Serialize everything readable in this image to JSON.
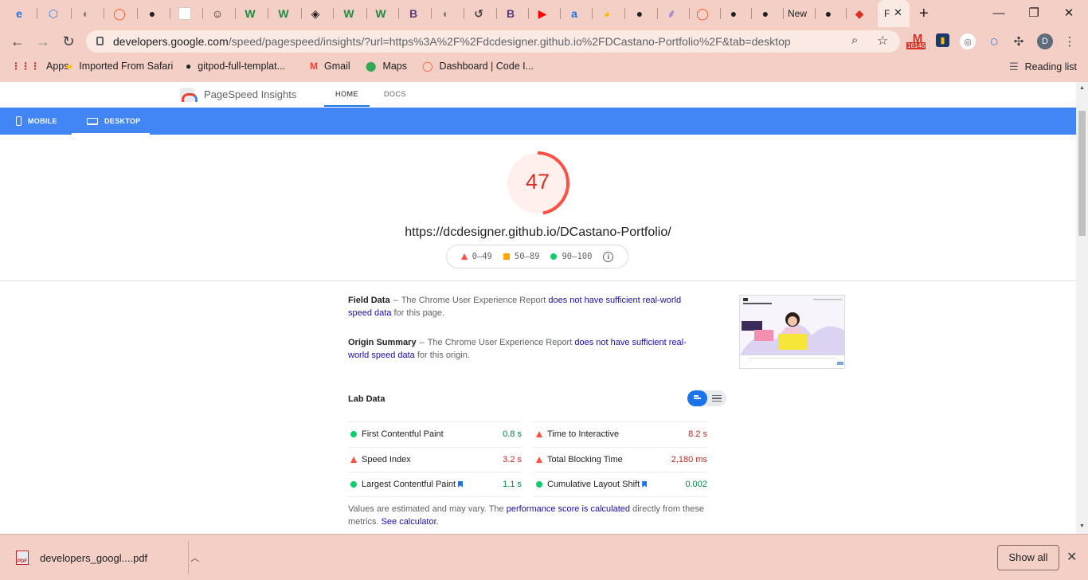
{
  "browser": {
    "tabs": [
      {
        "icon": "edge-blue-icon",
        "glyph": "e",
        "color": "#1a73e8"
      },
      {
        "icon": "hex-blue-icon",
        "glyph": "⬡",
        "color": "#3f7fd6"
      },
      {
        "icon": "globe-icon",
        "glyph": "◐",
        "color": "#7d7d7d"
      },
      {
        "icon": "orange-ring-icon",
        "glyph": "◯",
        "color": "#ff5722"
      },
      {
        "icon": "github-icon",
        "glyph": "●",
        "color": "#202124"
      },
      {
        "icon": "blank-page-icon",
        "glyph": "",
        "color": "#ffffff"
      },
      {
        "icon": "smiley-icon",
        "glyph": "☺",
        "color": "#202124"
      },
      {
        "icon": "w-green-icon",
        "glyph": "W",
        "color": "#1e8e3e"
      },
      {
        "icon": "w-green-icon",
        "glyph": "W",
        "color": "#1e8e3e"
      },
      {
        "icon": "codepen-icon",
        "glyph": "◈",
        "color": "#202124"
      },
      {
        "icon": "w-green-icon",
        "glyph": "W",
        "color": "#1e8e3e"
      },
      {
        "icon": "w-green-icon",
        "glyph": "W",
        "color": "#1e8e3e"
      },
      {
        "icon": "bootstrap-icon",
        "glyph": "B",
        "color": "#563d7c"
      },
      {
        "icon": "globe-icon",
        "glyph": "◐",
        "color": "#7d7d7d"
      },
      {
        "icon": "history-icon",
        "glyph": "↺",
        "color": "#3c4043"
      },
      {
        "icon": "bootstrap-icon",
        "glyph": "B",
        "color": "#563d7c"
      },
      {
        "icon": "youtube-icon",
        "glyph": "▶",
        "color": "#ff0000"
      },
      {
        "icon": "a-blue-icon",
        "glyph": "a",
        "color": "#1a73e8"
      },
      {
        "icon": "pie-icon",
        "glyph": "◕",
        "color": "#fbbc04"
      },
      {
        "icon": "black-dot-icon",
        "glyph": "●",
        "color": "#202124"
      },
      {
        "icon": "feather-icon",
        "glyph": "⸙",
        "color": "#a58bd6"
      },
      {
        "icon": "orange-ring-icon",
        "glyph": "◯",
        "color": "#ff5722"
      },
      {
        "icon": "github-icon",
        "glyph": "●",
        "color": "#202124"
      },
      {
        "icon": "github-icon",
        "glyph": "●",
        "color": "#202124"
      },
      {
        "icon": "new-tab-label",
        "glyph": "New",
        "color": "#202124"
      },
      {
        "icon": "github-icon",
        "glyph": "●",
        "color": "#202124"
      },
      {
        "icon": "red-diamond-icon",
        "glyph": "◆",
        "color": "#d93025"
      }
    ],
    "active_tab_text": "F",
    "address": {
      "host": "developers.google.com",
      "path": "/speed/pagespeed/insights/?url=https%3A%2F%2Fdcdesigner.github.io%2FDCastano-Portfolio%2F&tab=desktop"
    },
    "gmail_badge": "16146",
    "profile_initial": "D",
    "bookmarks": [
      {
        "label": "Apps",
        "icon": "apps-grid-icon"
      },
      {
        "label": "Imported From Safari",
        "icon": "folder-icon"
      },
      {
        "label": "gitpod-full-templat...",
        "icon": "github-icon"
      },
      {
        "label": "Gmail",
        "icon": "gmail-icon"
      },
      {
        "label": "Maps",
        "icon": "maps-pin-icon"
      },
      {
        "label": "Dashboard | Code I...",
        "icon": "orange-ring-icon"
      }
    ],
    "reading_list": "Reading list"
  },
  "psi": {
    "brand": "PageSpeed Insights",
    "nav": {
      "home": "HOME",
      "docs": "DOCS"
    },
    "devices": {
      "mobile": "MOBILE",
      "desktop": "DESKTOP"
    },
    "score": "47",
    "score_fraction": 0.47,
    "tested_url": "https://dcdesigner.github.io/DCastano-Portfolio/",
    "legend": {
      "fail": "0–49",
      "average": "50–89",
      "pass": "90–100"
    },
    "field_data": {
      "title": "Field Data",
      "dash": "–",
      "text_before": "The Chrome User Experience Report",
      "link": "does not have sufficient real-world speed data",
      "text_after": "for this page."
    },
    "origin_summary": {
      "title": "Origin Summary",
      "dash": "–",
      "text_before": "The Chrome User Experience Report",
      "link": "does not have sufficient real-world speed data",
      "text_after": "for this origin."
    },
    "lab_data": {
      "title": "Lab Data",
      "left": [
        {
          "name": "First Contentful Paint",
          "value": "0.8 s",
          "status": "good",
          "flag": false
        },
        {
          "name": "Speed Index",
          "value": "3.2 s",
          "status": "bad",
          "flag": false
        },
        {
          "name": "Largest Contentful Paint",
          "value": "1.1 s",
          "status": "good",
          "flag": true
        }
      ],
      "right": [
        {
          "name": "Time to Interactive",
          "value": "8.2 s",
          "status": "bad",
          "flag": false
        },
        {
          "name": "Total Blocking Time",
          "value": "2,180 ms",
          "status": "bad",
          "flag": false
        },
        {
          "name": "Cumulative Layout Shift",
          "value": "0.002",
          "status": "good",
          "flag": true
        }
      ]
    },
    "note": {
      "text1": "Values are estimated and may vary. The",
      "link1": "performance score is calculated",
      "text2": "directly from these metrics.",
      "link2": "See calculator."
    }
  },
  "downloads": {
    "file": "developers_googl....pdf",
    "pdf_label": "PDF",
    "show_all": "Show all"
  },
  "colors": {
    "fail": "#ff4e42",
    "average": "#ffa400",
    "pass": "#0cce6b",
    "accent": "#4285f4",
    "chrome": "#f3cfc6"
  }
}
